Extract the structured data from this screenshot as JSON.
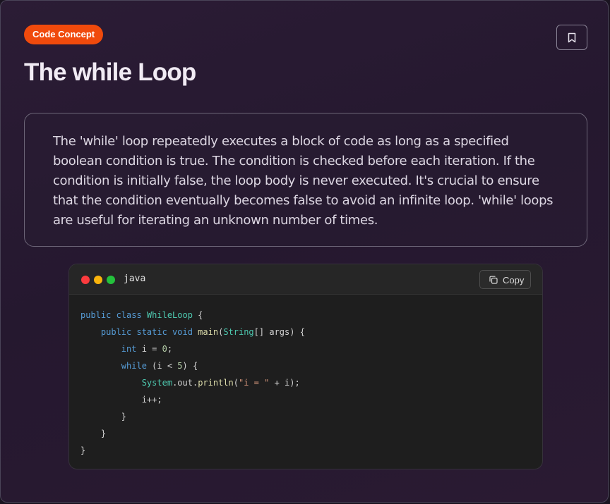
{
  "badge": {
    "label": "Code Concept"
  },
  "title": "The while Loop",
  "description": "The 'while' loop repeatedly executes a block of code as long as a specified boolean condition is true. The condition is checked before each iteration. If the condition is initially false, the loop body is never executed. It's crucial to ensure that the condition eventually becomes false to avoid an infinite loop. 'while' loops are useful for iterating an unknown number of times.",
  "bookmark": {
    "icon": "bookmark-icon"
  },
  "code_block": {
    "language": "java",
    "copy_label": "Copy",
    "copy_icon": "copy-icon",
    "window_dots": [
      "#fb3b3e",
      "#f9b40c",
      "#24c13c"
    ],
    "lines": [
      [
        {
          "t": "public class ",
          "c": "kw"
        },
        {
          "t": "WhileLoop",
          "c": "type"
        },
        {
          "t": " {",
          "c": "plain"
        }
      ],
      [
        {
          "t": "    public static void ",
          "c": "kw"
        },
        {
          "t": "main",
          "c": "fn"
        },
        {
          "t": "(",
          "c": "plain"
        },
        {
          "t": "String",
          "c": "type"
        },
        {
          "t": "[] args) {",
          "c": "plain"
        }
      ],
      [
        {
          "t": "        int ",
          "c": "kw"
        },
        {
          "t": "i = ",
          "c": "plain"
        },
        {
          "t": "0",
          "c": "num"
        },
        {
          "t": ";",
          "c": "plain"
        }
      ],
      [
        {
          "t": "        while ",
          "c": "kw"
        },
        {
          "t": "(i < ",
          "c": "plain"
        },
        {
          "t": "5",
          "c": "num"
        },
        {
          "t": ") {",
          "c": "plain"
        }
      ],
      [
        {
          "t": "            ",
          "c": "plain"
        },
        {
          "t": "System",
          "c": "type"
        },
        {
          "t": ".out.",
          "c": "plain"
        },
        {
          "t": "println",
          "c": "fn"
        },
        {
          "t": "(",
          "c": "plain"
        },
        {
          "t": "\"i = \"",
          "c": "str"
        },
        {
          "t": " + i);",
          "c": "plain"
        }
      ],
      [
        {
          "t": "            i++;",
          "c": "plain"
        }
      ],
      [
        {
          "t": "        }",
          "c": "plain"
        }
      ],
      [
        {
          "t": "    }",
          "c": "plain"
        }
      ],
      [
        {
          "t": "}",
          "c": "plain"
        }
      ]
    ]
  },
  "colors": {
    "badge_bg": "#f04a0c",
    "card_bg": "#2b1c35",
    "code_bg": "#1e1e1e",
    "keyword": "#569cd6",
    "type": "#4ec9b0",
    "function": "#dcdcaa",
    "number": "#b5cea8",
    "string": "#ce9178"
  }
}
